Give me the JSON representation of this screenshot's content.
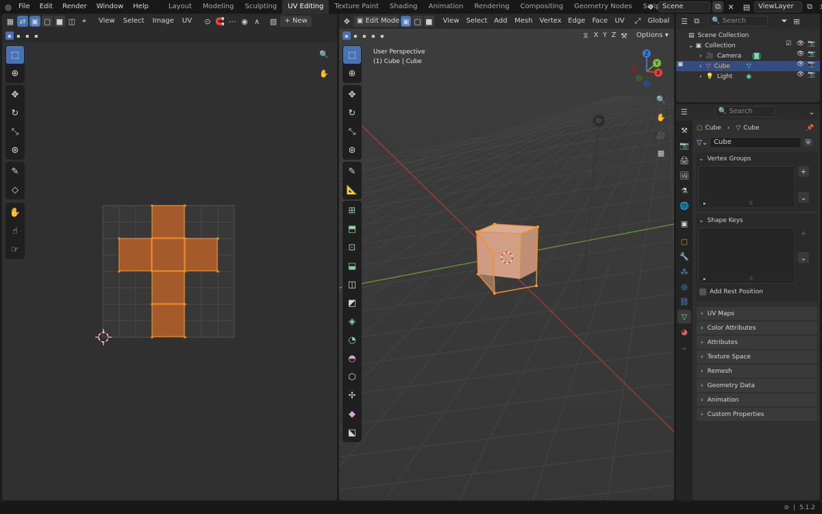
{
  "topbar": {
    "menus": [
      "File",
      "Edit",
      "Render",
      "Window",
      "Help"
    ],
    "workspaces": [
      "Layout",
      "Modeling",
      "Sculpting",
      "UV Editing",
      "Texture Paint",
      "Shading",
      "Animation",
      "Rendering",
      "Compositing",
      "Geometry Nodes",
      "Scripting"
    ],
    "active_workspace": "UV Editing",
    "add_tab": "+",
    "scene": "Scene",
    "view_layer": "ViewLayer"
  },
  "uv_editor": {
    "menus": [
      "View",
      "Select",
      "Image",
      "UV"
    ],
    "new_button": "New",
    "add_symbol": "+",
    "colors": {
      "face": "#a45a2a",
      "edge": "#e88a2a"
    }
  },
  "viewport": {
    "mode": "Edit Mode",
    "menus": [
      "View",
      "Select",
      "Add",
      "Mesh",
      "Vertex",
      "Edge",
      "Face",
      "UV"
    ],
    "transform": "Global",
    "axes": [
      "X",
      "Y",
      "Z"
    ],
    "options": "Options",
    "overlay_title": "User Perspective",
    "overlay_object": "(1) Cube | Cube",
    "gizmo": {
      "x": "X",
      "y": "Y",
      "z": "Z"
    }
  },
  "outliner": {
    "search_placeholder": "Search",
    "scene_collection": "Scene Collection",
    "collection": "Collection",
    "items": [
      "Camera",
      "Cube",
      "Light"
    ],
    "selected": "Cube"
  },
  "properties": {
    "search_placeholder": "Search",
    "breadcrumb": [
      "Cube",
      "Cube"
    ],
    "mesh_name": "Cube",
    "vertex_groups": "Vertex Groups",
    "shape_keys": "Shape Keys",
    "add_rest_position": "Add Rest Position",
    "collapsed_panels": [
      "UV Maps",
      "Color Attributes",
      "Attributes",
      "Texture Space",
      "Remesh",
      "Geometry Data",
      "Animation",
      "Custom Properties"
    ]
  },
  "statusbar": {
    "version": "5.1.2"
  }
}
